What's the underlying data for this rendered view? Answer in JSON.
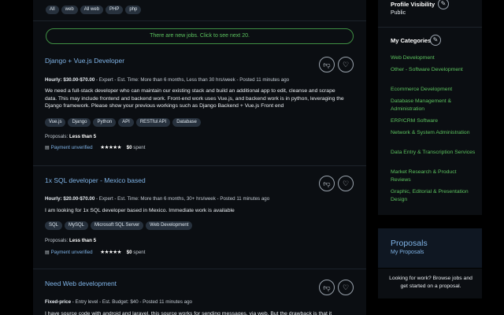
{
  "top_tags": [
    "All",
    "web",
    "All web",
    "PHP",
    "php"
  ],
  "new_jobs_notice": "There are new jobs. Click to see next 20.",
  "jobs": [
    {
      "title": "Django + Vue.js Developer",
      "meta_type": "Hourly: $30.00-$70.00",
      "meta_rest": " - Expert - Est. Time: More than 6 months, Less than 30 hrs/week - Posted 11 minutes ago",
      "description": "We need a full-stack developer who can maintain our existing stack and build an additional app to edit, cleanse and scrape data. This may include frontend and backend work. Front-end work uses Vue.js, and backend work is in python, leveraging the Django framework. Please show your previous workings such as Django Backend + Vue.js Front end",
      "tags": [
        "Vue.js",
        "Django",
        "Python",
        "API",
        "RESTful API",
        "Database"
      ],
      "proposals_label": "Proposals:",
      "proposals_value": "Less than 5",
      "payment": "Payment unverified",
      "rating": "★★★★★",
      "spent_value": "$0",
      "spent_label": "spent"
    },
    {
      "title": "1x SQL developer - Mexico based",
      "meta_type": "Hourly: $20.00-$70.00",
      "meta_rest": " - Expert - Est. Time: More than 6 months, 30+ hrs/week - Posted 11 minutes ago",
      "description": "I am looking for 1x SQL developer based in Mexico. Immediate work is available",
      "tags": [
        "SQL",
        "MySQL",
        "Microsoft SQL Server",
        "Web Development"
      ],
      "proposals_label": "Proposals:",
      "proposals_value": "Less than 5",
      "payment": "Payment unverified",
      "rating": "★★★★★",
      "spent_value": "$0",
      "spent_label": "spent"
    },
    {
      "title": "Need Web development",
      "meta_type": "Fixed-price",
      "meta_rest": " - Entry level - Est. Budget: $40 - Posted 11 minutes ago",
      "description": "I have source code with android and laravel. this source works for sending messages, via web. But the drawback is that it"
    }
  ],
  "icons": {
    "dislike": "thumbs-down-icon",
    "save": "heart-icon",
    "edit": "pencil-icon",
    "payment": "card-icon"
  },
  "sidebar": {
    "profile_visibility_label": "Profile Visibility",
    "profile_visibility_value": "Public",
    "categories_title": "My Categories",
    "categories": [
      "Web Development",
      "Other - Software Development",
      "Ecommerce Development",
      "Database Management & Administration",
      "ERP/CRM Software",
      "Network & System Administration",
      "Data Entry & Transcription Services",
      "Market Research & Product Reviews",
      "Graphic, Editorial & Presentation Design"
    ],
    "proposals_title": "Proposals",
    "my_proposals": "My Proposals",
    "work_text": "Looking for work? Browse jobs and get started on a proposal."
  },
  "colors": {
    "link_blue": "#7fb3e6",
    "category_green": "#5cc25f",
    "panel": "#0b0e12"
  }
}
